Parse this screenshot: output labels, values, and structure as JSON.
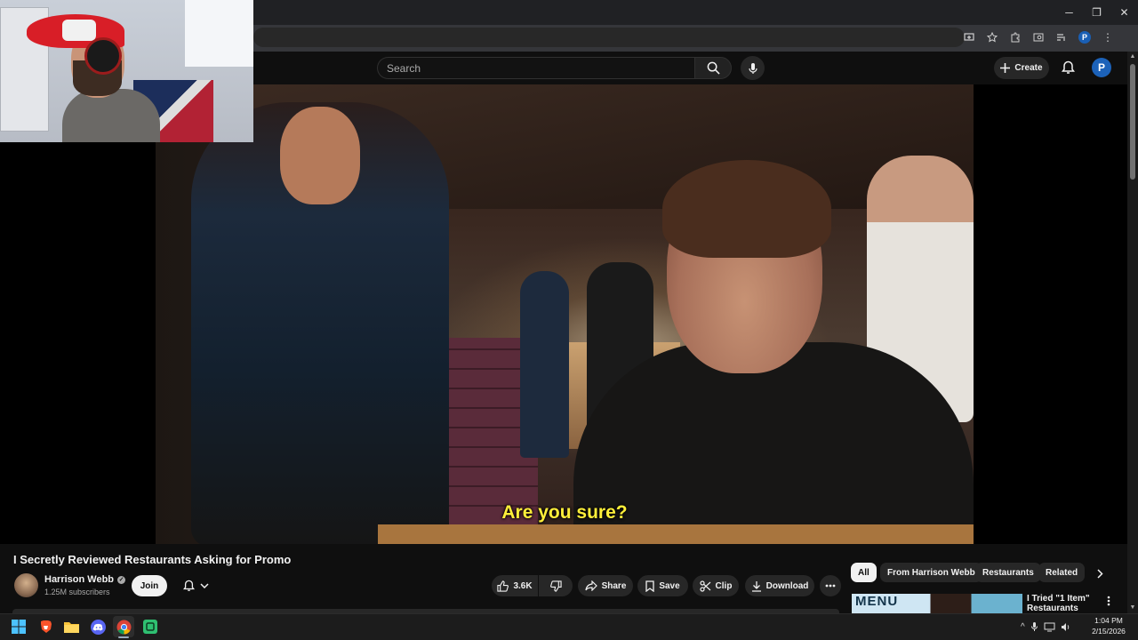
{
  "browser": {
    "window_controls": {
      "minimize": "─",
      "restore": "❐",
      "close": "✕"
    }
  },
  "header": {
    "search_placeholder": "Search",
    "create_label": "Create",
    "avatar_letter": "P"
  },
  "player": {
    "subtitle": "Are you sure?"
  },
  "video": {
    "title": "I Secretly Reviewed Restaurants Asking for Promo",
    "channel": {
      "name": "Harrison Webb",
      "subscribers": "1.25M subscribers",
      "join_label": "Join"
    },
    "actions": {
      "likes": "3.6K",
      "share": "Share",
      "save": "Save",
      "clip": "Clip",
      "download": "Download"
    }
  },
  "chips": {
    "all": "All",
    "from_channel": "From Harrison Webb",
    "restaurants": "Restaurants",
    "related": "Related"
  },
  "recommendation": {
    "thumb_text": "MENU",
    "title": "I Tried \"1 Item\" Restaurants"
  },
  "taskbar": {
    "time": "1:04 PM",
    "date": "2/15/2026"
  },
  "colors": {
    "background": "#0f0f0f",
    "chip_active": "#f1f1f1",
    "subtitle": "#ffef3a",
    "avatar": "#1c62b9"
  }
}
